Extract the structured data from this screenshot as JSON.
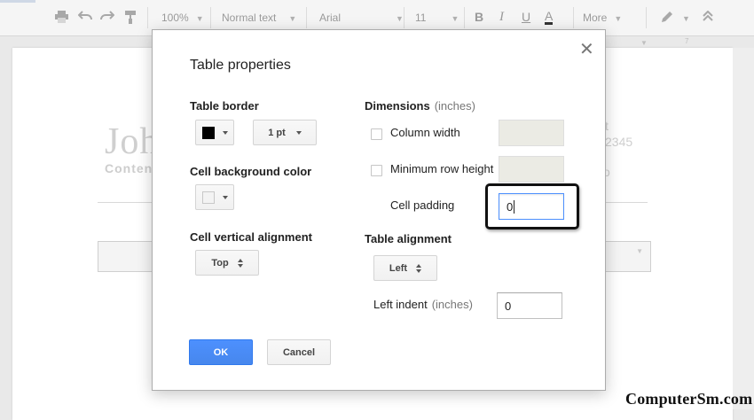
{
  "toolbar": {
    "zoom": "100%",
    "style": "Normal text",
    "font": "Arial",
    "size": "11",
    "more": "More",
    "bold": "B",
    "italic": "I",
    "underline": "U",
    "text_color": "A"
  },
  "background_doc": {
    "name_partial": "Joh",
    "sub_partial": "Conten",
    "right_line1": "t",
    "right_line2": "2345",
    "right_line3": "o"
  },
  "dialog": {
    "title": "Table properties",
    "close_glyph": "✕",
    "table_border": {
      "heading": "Table border",
      "color": "#000000",
      "width_value": "1 pt"
    },
    "cell_background": {
      "heading": "Cell background color",
      "color": "#f3f3f3"
    },
    "cell_vertical_alignment": {
      "heading": "Cell vertical alignment",
      "value": "Top"
    },
    "dimensions": {
      "heading": "Dimensions",
      "unit": "(inches)",
      "column_width_label": "Column width",
      "column_width_checked": false,
      "min_row_height_label": "Minimum row height",
      "min_row_height_checked": false,
      "cell_padding_label": "Cell padding",
      "cell_padding_value": "0"
    },
    "table_alignment": {
      "heading": "Table alignment",
      "value": "Left",
      "left_indent_label": "Left indent",
      "left_indent_unit": "(inches)",
      "left_indent_value": "0"
    },
    "ok_label": "OK",
    "cancel_label": "Cancel"
  },
  "colors": {
    "primary_button": "#4d90fe",
    "focus_border": "#4d90fe"
  },
  "watermark": "ComputerSm.com"
}
